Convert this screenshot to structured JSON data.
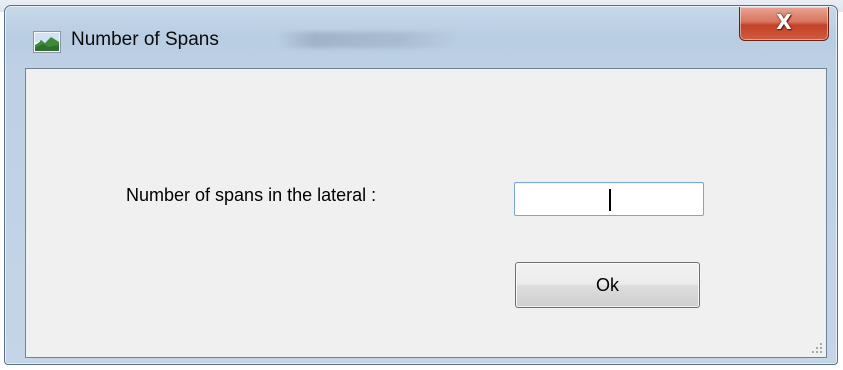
{
  "window": {
    "title": "Number of Spans",
    "close_glyph": "X",
    "app_icon": "landscape-app-icon"
  },
  "form": {
    "prompt_label": "Number of spans in the lateral :",
    "spans_input_value": "",
    "ok_label": "Ok"
  },
  "colors": {
    "frame": "#bdd0e4",
    "close_button": "#c4412a",
    "client_background": "#f0f0f0",
    "input_border": "#7aa7d6"
  }
}
